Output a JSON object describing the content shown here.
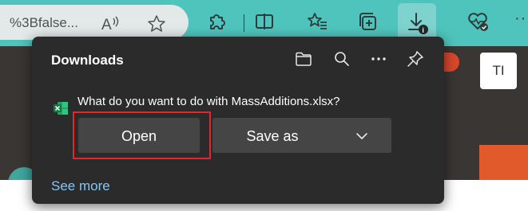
{
  "toolbar": {
    "address_text": "%3Bfalse...",
    "icons": [
      "read-aloud-icon",
      "favorite-star-icon",
      "extensions-icon",
      "split-screen-icon",
      "favorites-icon",
      "collections-icon",
      "downloads-icon",
      "browser-essentials-icon",
      "more-icon"
    ],
    "more_label": "···"
  },
  "page": {
    "avatar_initials": "TI"
  },
  "downloads": {
    "title": "Downloads",
    "question": "What do you want to do with MassAdditions.xlsx?",
    "open_label": "Open",
    "save_as_label": "Save as",
    "see_more_label": "See more",
    "icons": [
      "folder-icon",
      "search-icon",
      "more-options-icon",
      "pin-icon"
    ]
  },
  "colors": {
    "toolbar_teal": "#4fc4bd",
    "flyout_bg": "#2b2b2b",
    "button_bg": "#454545",
    "link_blue": "#8ac4f0",
    "highlight_red": "#e2282d"
  }
}
